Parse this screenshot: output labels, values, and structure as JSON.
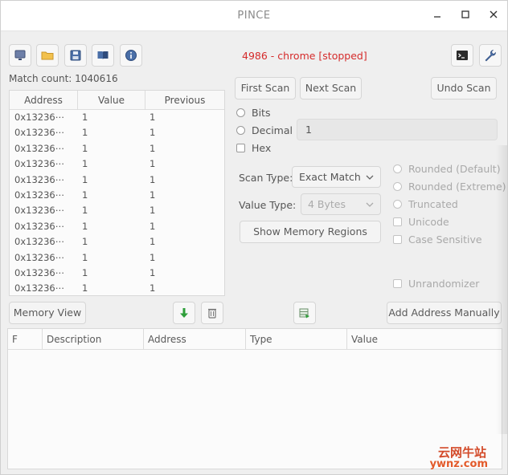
{
  "window": {
    "title": "PINCE"
  },
  "toolbar": {
    "icons": [
      "monitor-icon",
      "folder-icon",
      "save-icon",
      "book-icon",
      "info-icon"
    ],
    "right_icons": [
      "terminal-icon",
      "wrench-icon"
    ]
  },
  "process": {
    "status": "4986 - chrome  [stopped]"
  },
  "scan": {
    "match_count": "Match count: 1040616",
    "columns": [
      "Address",
      "Value",
      "Previous"
    ],
    "rows": [
      [
        "0x13236⋯",
        "1",
        "1"
      ],
      [
        "0x13236⋯",
        "1",
        "1"
      ],
      [
        "0x13236⋯",
        "1",
        "1"
      ],
      [
        "0x13236⋯",
        "1",
        "1"
      ],
      [
        "0x13236⋯",
        "1",
        "1"
      ],
      [
        "0x13236⋯",
        "1",
        "1"
      ],
      [
        "0x13236⋯",
        "1",
        "1"
      ],
      [
        "0x13236⋯",
        "1",
        "1"
      ],
      [
        "0x13236⋯",
        "1",
        "1"
      ],
      [
        "0x13236⋯",
        "1",
        "1"
      ],
      [
        "0x13236⋯",
        "1",
        "1"
      ],
      [
        "0x13236⋯",
        "1",
        "1"
      ]
    ],
    "first_scan": "First Scan",
    "next_scan": "Next Scan",
    "undo_scan": "Undo Scan",
    "radio_bits": "Bits",
    "radio_decimal": "Decimal",
    "check_hex": "Hex",
    "value": "1",
    "scan_type_label": "Scan Type:",
    "scan_type_value": "Exact Match",
    "value_type_label": "Value Type:",
    "value_type_value": "4 Bytes",
    "show_memory_regions": "Show Memory Regions",
    "options": {
      "rounded_default": "Rounded (Default)",
      "rounded_extreme": "Rounded (Extreme)",
      "truncated": "Truncated",
      "unicode": "Unicode",
      "case_sensitive": "Case Sensitive",
      "unrandomizer": "Unrandomizer"
    }
  },
  "bottom": {
    "memory_view": "Memory View",
    "add_address_manually": "Add Address Manually",
    "columns": [
      "F",
      "Description",
      "Address",
      "Type",
      "Value"
    ]
  },
  "watermark": {
    "text": "云网牛站",
    "sub": "ywnz.com"
  },
  "colors": {
    "process_status": "#d52b2b",
    "accent_green": "#2e9e3a"
  }
}
